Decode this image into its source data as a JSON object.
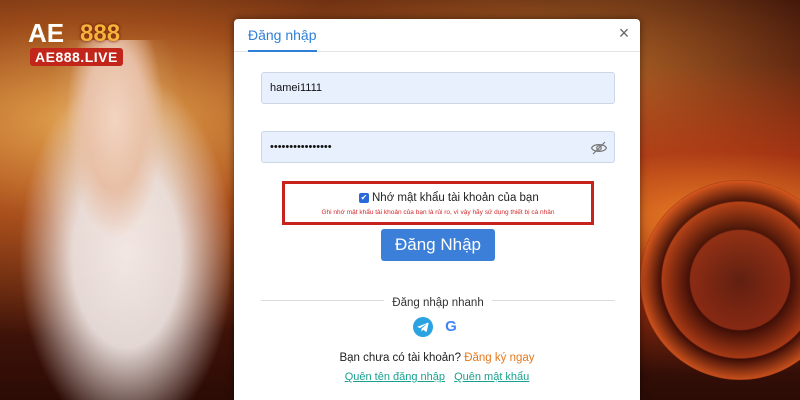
{
  "brand": {
    "logo_ae": "AE",
    "logo_888": "888",
    "logo_live": "AE888.LIVE"
  },
  "modal": {
    "tab_login": "Đăng nhập",
    "close_symbol": "×",
    "username": {
      "value": "hamei1111",
      "placeholder": ""
    },
    "password": {
      "value": "••••••••••••••••",
      "placeholder": ""
    },
    "remember": {
      "checked": true,
      "label": "Nhớ mật khẩu tài khoản của bạn",
      "warning": "Ghi nhớ mật khẩu tài khoản của bạn là rủi ro, vì vậy hãy sử dụng thiết bị cá nhân"
    },
    "login_button": "Đăng Nhập",
    "quick_login_title": "Đăng nhập nhanh",
    "social": {
      "google_letter": "G"
    },
    "signup_prompt": "Bạn chưa có tài khoản?",
    "signup_link": "Đăng ký ngay",
    "forgot_username": "Quên tên đăng nhập",
    "forgot_password": "Quên mật khẩu"
  },
  "colors": {
    "accent_blue": "#3b7fd8",
    "highlight_red": "#c8221d",
    "signup_orange": "#e6791b",
    "link_teal": "#1aa18e",
    "telegram_blue": "#2aa3e0"
  },
  "icons": {
    "close": "close-icon",
    "password_visibility": "eye-off-icon",
    "telegram": "telegram-icon",
    "google": "google-icon",
    "checkbox": "checkbox-checked-icon"
  }
}
